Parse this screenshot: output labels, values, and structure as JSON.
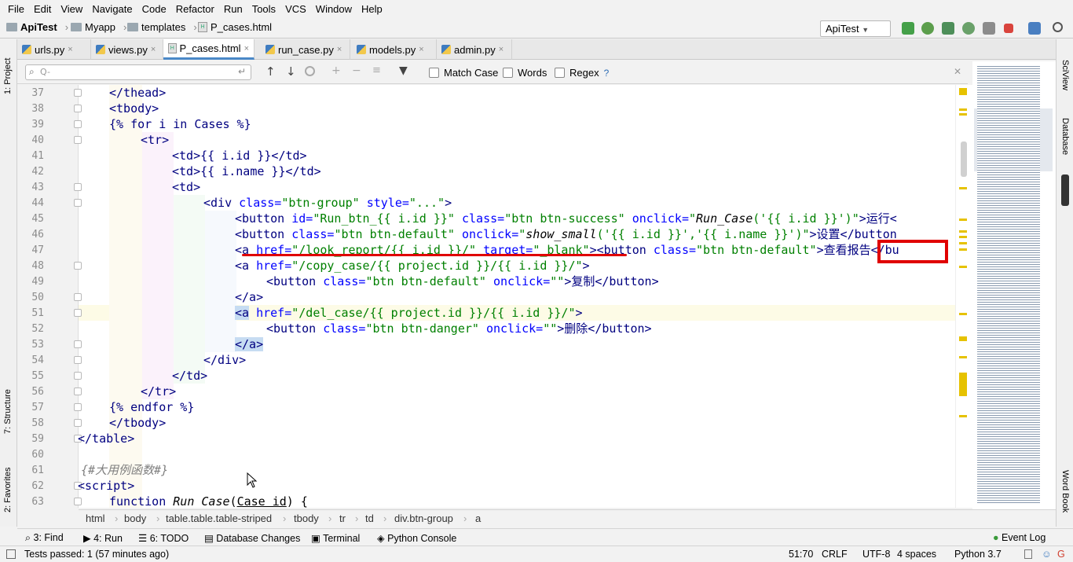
{
  "menu": [
    "File",
    "Edit",
    "View",
    "Navigate",
    "Code",
    "Refactor",
    "Run",
    "Tools",
    "VCS",
    "Window",
    "Help"
  ],
  "nav": {
    "project": "ApiTest",
    "dir1": "Myapp",
    "dir2": "templates",
    "file": "P_cases.html",
    "run_config": "ApiTest"
  },
  "tabs": [
    {
      "label": "urls.py",
      "kind": "py"
    },
    {
      "label": "views.py",
      "kind": "py"
    },
    {
      "label": "P_cases.html",
      "kind": "html",
      "active": true
    },
    {
      "label": "run_case.py",
      "kind": "py"
    },
    {
      "label": "models.py",
      "kind": "py"
    },
    {
      "label": "admin.py",
      "kind": "py"
    }
  ],
  "search": {
    "placeholder": "Q-",
    "match_case": "Match Case",
    "words": "Words",
    "regex": "Regex",
    "help": "?"
  },
  "left_tools": {
    "project": "1: Project",
    "structure": "7: Structure",
    "favorites": "2: Favorites"
  },
  "right_tools": {
    "sciview": "SciView",
    "database": "Database",
    "wordbook": "Word Book"
  },
  "line_numbers": [
    "37",
    "38",
    "39",
    "40",
    "41",
    "42",
    "43",
    "44",
    "45",
    "46",
    "47",
    "48",
    "49",
    "50",
    "51",
    "52",
    "53",
    "54",
    "55",
    "56",
    "57",
    "58",
    "59",
    "60",
    "61",
    "62",
    "63"
  ],
  "code": {
    "l37": "</thead>",
    "l38": "<tbody>",
    "l39a": "{% for i in Cases %}",
    "l40": "<tr>",
    "l41": "<td>{{ i.id }}</td>",
    "l42": "<td>{{ i.name }}</td>",
    "l43": "<td>",
    "l44a": "<div ",
    "l44b": "class=",
    "l44c": "\"btn-group\" ",
    "l44d": "style=",
    "l44e": "\"...\"",
    "l44f": ">",
    "l45a": "<button ",
    "l45b": "id=",
    "l45c": "\"Run_btn_{{ i.id }}\" ",
    "l45d": "class=",
    "l45e": "\"btn btn-success\" ",
    "l45f": "onclick=",
    "l45g": "\"",
    "l45h": "Run_Case",
    "l45i": "('{{ i.id }}')\"",
    "l45j": ">运行<",
    "l46a": "<button ",
    "l46b": "class=",
    "l46c": "\"btn btn-default\" ",
    "l46d": "onclick=",
    "l46e": "\"",
    "l46f": "show_small",
    "l46g": "('{{ i.id }}','{{ i.name }}')\"",
    "l46h": ">设置</button",
    "l47a": "<a ",
    "l47b": "href=",
    "l47c": "\"/look_report/{{ i.id }}/\" ",
    "l47d": "target=",
    "l47e": "\"_blank\"",
    "l47f": "><button ",
    "l47g": "class=",
    "l47h": "\"btn btn-default\"",
    "l47i": ">查看报告</bu",
    "l48a": "<a ",
    "l48b": "href=",
    "l48c": "\"/copy_case/{{ project.id }}/{{ i.id }}/\"",
    "l48d": ">",
    "l49a": "<button ",
    "l49b": "class=",
    "l49c": "\"btn btn-default\" ",
    "l49d": "onclick=",
    "l49e": "\"\"",
    "l49f": ">复制</button>",
    "l50": "</a>",
    "l51a": "<a",
    "l51b": " href=",
    "l51c": "\"/del_case/{{ project.id }}/{{ i.id }}/\"",
    "l51d": ">",
    "l52a": "<button ",
    "l52b": "class=",
    "l52c": "\"btn btn-danger\" ",
    "l52d": "onclick=",
    "l52e": "\"\"",
    "l52f": ">删除</button>",
    "l53": "</a>",
    "l54": "</div>",
    "l55": "</td>",
    "l56": "</tr>",
    "l57": "{% endfor %}",
    "l58": "</tbody>",
    "l59": "</table>",
    "l61": "{#大用例函数#}",
    "l62": "<script>",
    "l63a": "function ",
    "l63b": "Run_Case",
    "l63c": "(",
    "l63d": "Case_id",
    "l63e": ") {"
  },
  "breadcrumbs": [
    "html",
    "body",
    "table.table.table-striped",
    "tbody",
    "tr",
    "td",
    "div.btn-group",
    "a"
  ],
  "tool_windows": {
    "find": "3: Find",
    "run": "4: Run",
    "todo": "6: TODO",
    "db_changes": "Database Changes",
    "terminal": "Terminal",
    "python_console": "Python Console",
    "event_log": "Event Log"
  },
  "status": {
    "tests": "Tests passed: 1 (57 minutes ago)",
    "position": "51:70",
    "line_sep": "CRLF",
    "encoding": "UTF-8",
    "indent": "4 spaces",
    "interpreter": "Python 3.7"
  },
  "colors": {
    "annotation": "#e00000",
    "tag": "#000080",
    "attribute": "#0000ff",
    "string": "#008000"
  }
}
